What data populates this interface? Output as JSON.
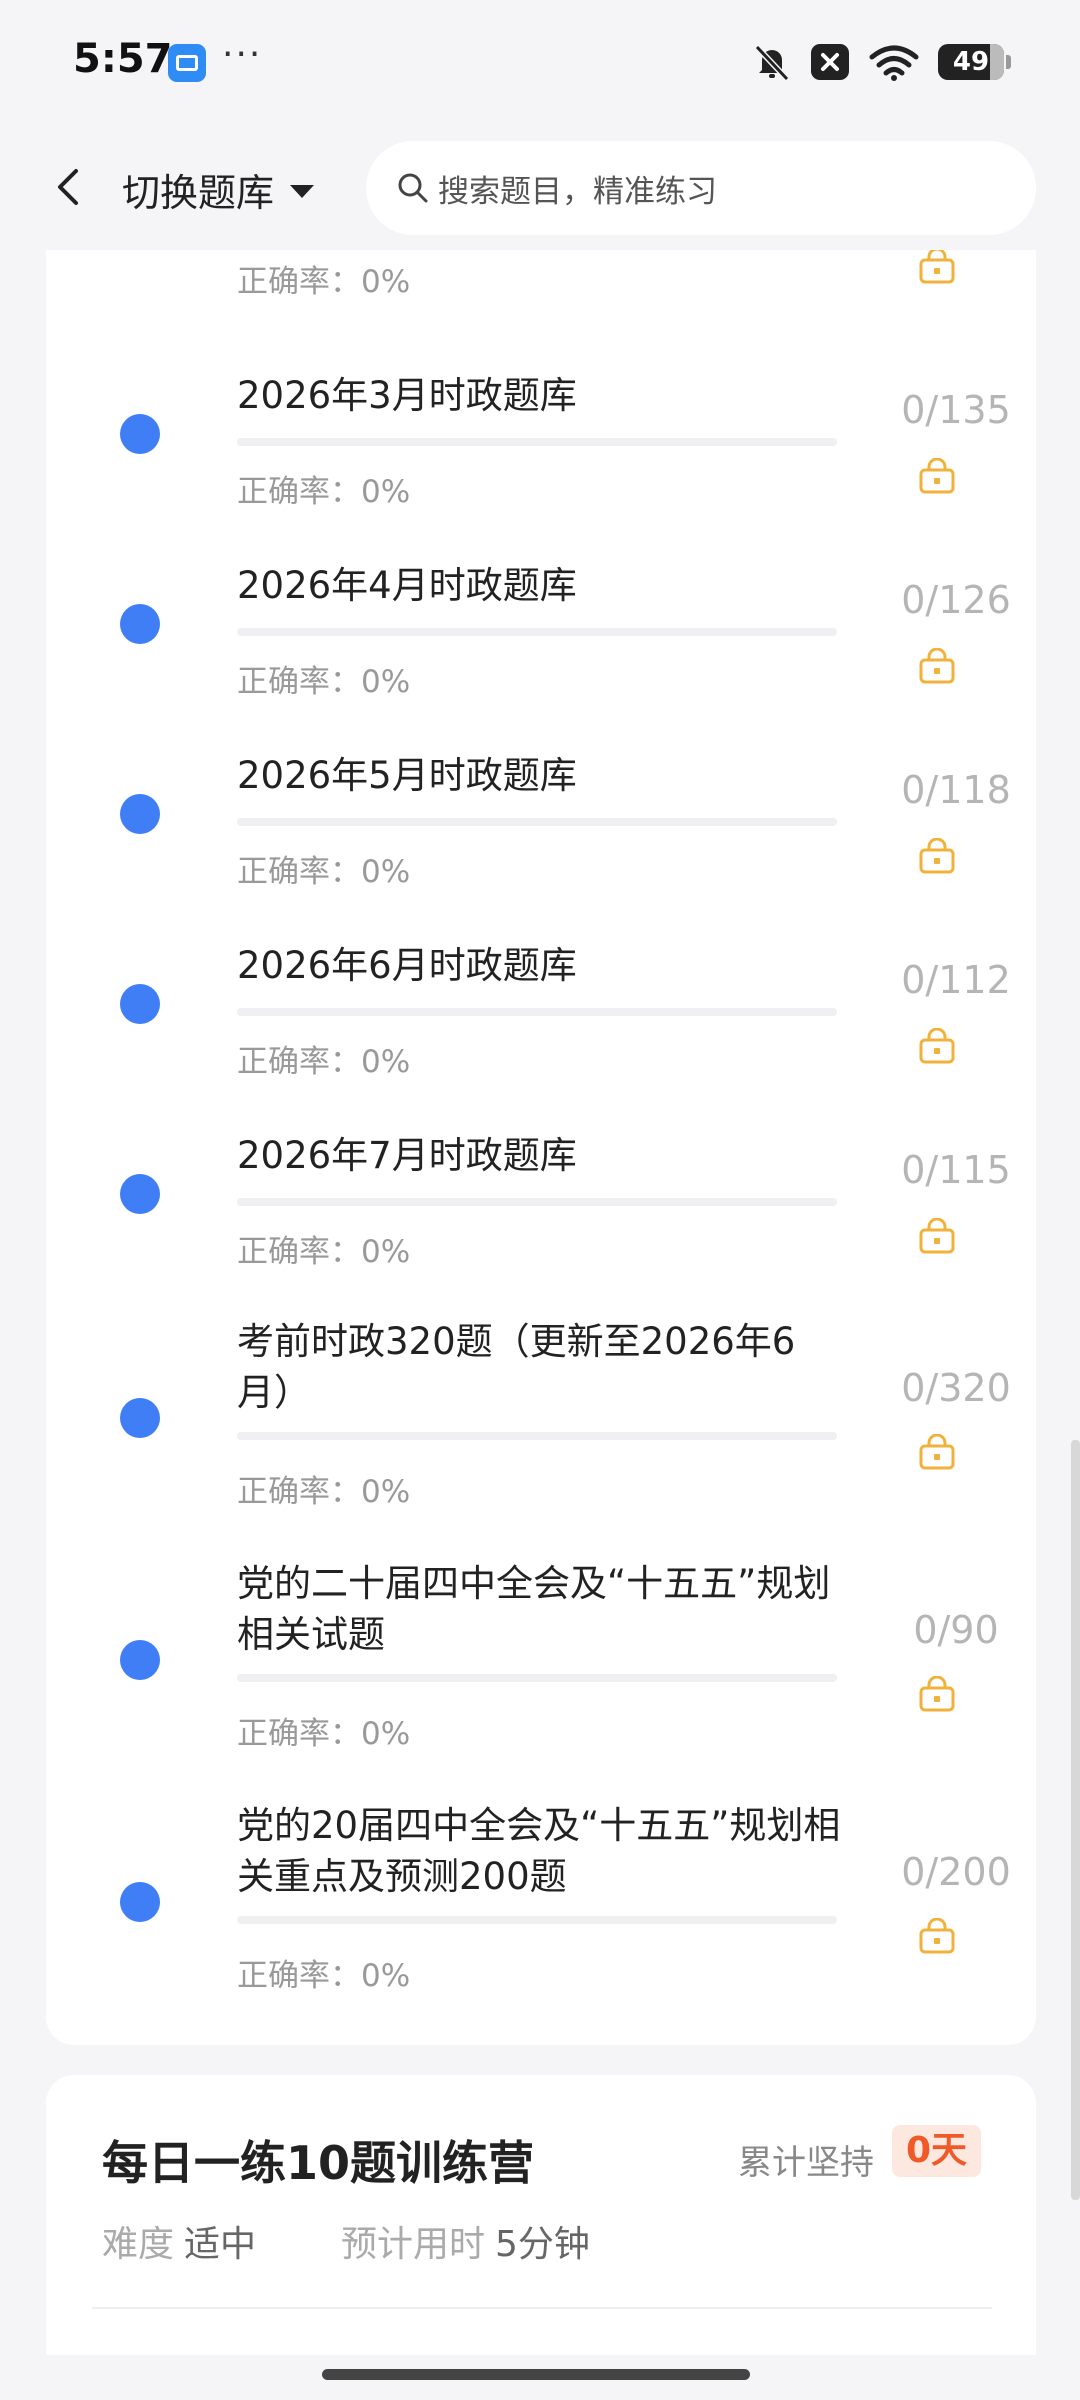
{
  "status_bar": {
    "time": "5:57",
    "more": "···",
    "battery": "49"
  },
  "header": {
    "title": "切换题库",
    "search_placeholder": "搜索题目，精准练习"
  },
  "items": [
    {
      "title": "",
      "count": "",
      "rate_label": "正确率：",
      "rate": "0%"
    },
    {
      "title": "2026年3月时政题库",
      "count": "0/135",
      "rate_label": "正确率：",
      "rate": "0%"
    },
    {
      "title": "2026年4月时政题库",
      "count": "0/126",
      "rate_label": "正确率：",
      "rate": "0%"
    },
    {
      "title": "2026年5月时政题库",
      "count": "0/118",
      "rate_label": "正确率：",
      "rate": "0%"
    },
    {
      "title": "2026年6月时政题库",
      "count": "0/112",
      "rate_label": "正确率：",
      "rate": "0%"
    },
    {
      "title": "2026年7月时政题库",
      "count": "0/115",
      "rate_label": "正确率：",
      "rate": "0%"
    },
    {
      "title": "考前时政320题（更新至2026年6月）",
      "count": "0/320",
      "rate_label": "正确率：",
      "rate": "0%"
    },
    {
      "title": "党的二十届四中全会及“十五五”规划相关试题",
      "count": "0/90",
      "rate_label": "正确率：",
      "rate": "0%"
    },
    {
      "title": "党的20届四中全会及“十五五”规划相关重点及预测200题",
      "count": "0/200",
      "rate_label": "正确率：",
      "rate": "0%"
    }
  ],
  "camp": {
    "title": "每日一练10题训练营",
    "streak_label": "累计坚持",
    "streak_value": "0天",
    "difficulty_label": "难度",
    "difficulty_value": "适中",
    "time_label": "预计用时",
    "time_value": "5分钟"
  },
  "colors": {
    "accent_blue": "#3f7ef5",
    "lock_orange": "#f0b23a",
    "streak_orange": "#f05a28"
  }
}
